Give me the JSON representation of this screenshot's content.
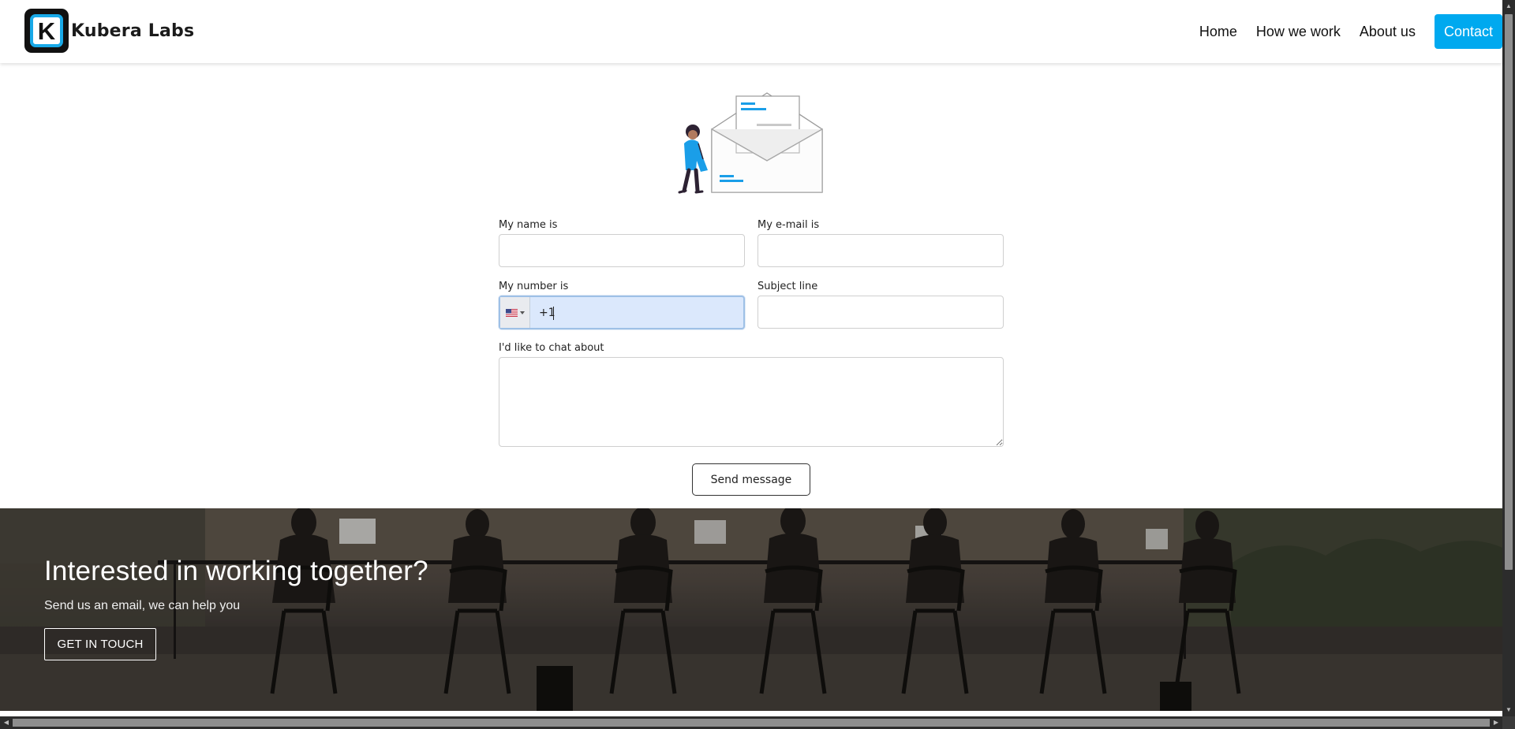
{
  "header": {
    "logo_letter": "K",
    "logo_text": "Kubera Labs",
    "nav": {
      "home": "Home",
      "how_we_work": "How we work",
      "about_us": "About us",
      "contact": "Contact"
    },
    "accent_color": "#00a9ef"
  },
  "form": {
    "name_label": "My name is",
    "name_value": "",
    "email_label": "My e-mail is",
    "email_value": "",
    "number_label": "My number is",
    "number_value": "+1",
    "number_country_flag": "us-flag-icon",
    "subject_label": "Subject line",
    "subject_value": "",
    "chat_label": "I'd like to chat about",
    "chat_value": "",
    "send_label": "Send message"
  },
  "hero": {
    "title": "Interested in working together?",
    "subtitle": "Send us an email, we can help you",
    "cta": "GET IN TOUCH"
  },
  "scrollbars": {
    "vertical_arrow_up": "▲",
    "vertical_arrow_down": "▼",
    "horizontal_arrow_left": "◀",
    "horizontal_arrow_right": "▶"
  }
}
